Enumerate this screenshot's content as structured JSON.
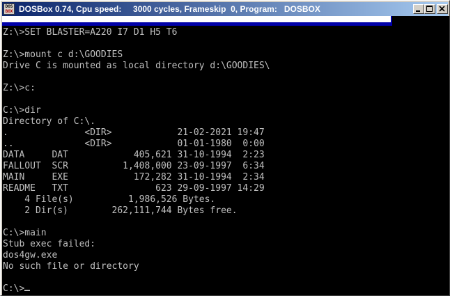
{
  "window": {
    "title": "DOSBox 0.74, Cpu speed:     3000 cycles, Frameskip  0, Program:   DOSBOX",
    "icon_lines": [
      "DOS",
      "BOX"
    ],
    "icon": "dosbox-app-icon",
    "title_gradient": [
      "#0a246a",
      "#a6caf0"
    ]
  },
  "controls": {
    "minimize_icon": "minimize-icon",
    "maximize_icon": "maximize-icon",
    "close_icon": "close-icon"
  },
  "terminal": {
    "background": "#000000",
    "foreground": "#c0c0c0",
    "lines": [
      "Z:\\>SET BLASTER=A220 I7 D1 H5 T6",
      "",
      "Z:\\>mount c d:\\GOODIES",
      "Drive C is mounted as local directory d:\\GOODIES\\",
      "",
      "Z:\\>c:",
      "",
      "C:\\>dir",
      "Directory of C:\\.",
      ".              <DIR>            21-02-2021 19:47",
      "..             <DIR>            01-01-1980  0:00",
      "DATA     DAT            405,621 31-10-1994  2:23",
      "FALLOUT  SCR          1,408,000 23-09-1997  6:34",
      "MAIN     EXE            172,282 31-10-1994  2:34",
      "README   TXT                623 29-09-1997 14:29",
      "    4 File(s)          1,986,526 Bytes.",
      "    2 Dir(s)        262,111,744 Bytes free.",
      "",
      "C:\\>main",
      "Stub exec failed:",
      "dos4gw.exe",
      "No such file or directory",
      ""
    ],
    "prompt": "C:\\>"
  }
}
